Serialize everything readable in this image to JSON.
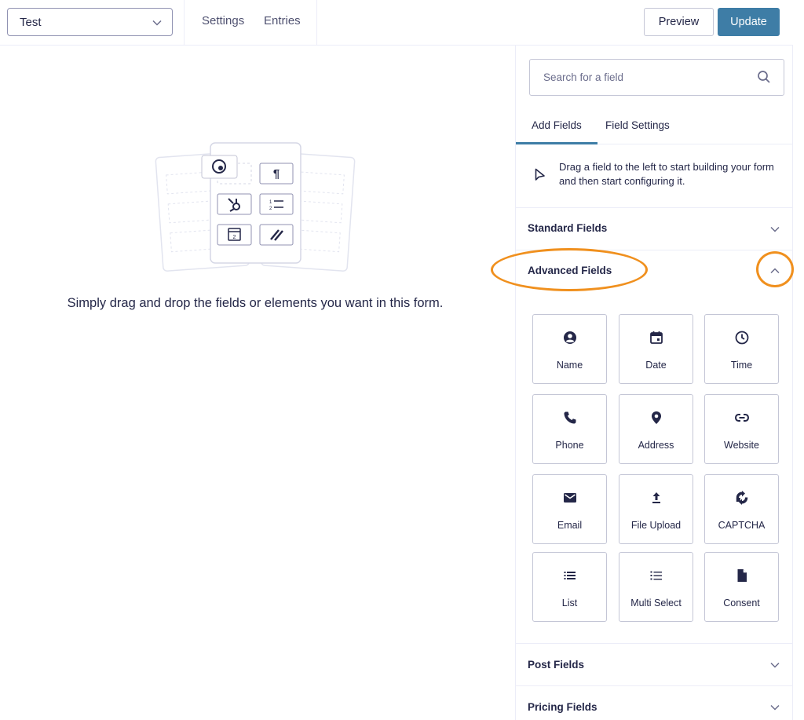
{
  "topbar": {
    "form_selector": {
      "value": "Test"
    },
    "nav": {
      "settings": "Settings",
      "entries": "Entries"
    },
    "preview_label": "Preview",
    "update_label": "Update"
  },
  "canvas": {
    "empty_message": "Simply drag and drop the fields or elements you want in this form."
  },
  "sidebar": {
    "search": {
      "placeholder": "Search for a field",
      "value": ""
    },
    "tabs": [
      {
        "label": "Add Fields",
        "active": true
      },
      {
        "label": "Field Settings",
        "active": false
      }
    ],
    "hint": "Drag a field to the left to start building your form and then start configuring it.",
    "sections": [
      {
        "title": "Standard Fields",
        "expanded": false
      },
      {
        "title": "Advanced Fields",
        "expanded": true
      },
      {
        "title": "Post Fields",
        "expanded": false
      },
      {
        "title": "Pricing Fields",
        "expanded": false
      }
    ],
    "advanced_fields": [
      {
        "label": "Name",
        "icon": "user-circle-icon"
      },
      {
        "label": "Date",
        "icon": "calendar-icon"
      },
      {
        "label": "Time",
        "icon": "clock-icon"
      },
      {
        "label": "Phone",
        "icon": "phone-icon"
      },
      {
        "label": "Address",
        "icon": "map-pin-icon"
      },
      {
        "label": "Website",
        "icon": "link-icon"
      },
      {
        "label": "Email",
        "icon": "envelope-icon"
      },
      {
        "label": "File Upload",
        "icon": "upload-icon"
      },
      {
        "label": "CAPTCHA",
        "icon": "captcha-icon"
      },
      {
        "label": "List",
        "icon": "list-icon"
      },
      {
        "label": "Multi Select",
        "icon": "multi-select-icon"
      },
      {
        "label": "Consent",
        "icon": "document-icon"
      }
    ]
  },
  "colors": {
    "primary": "#3e7da6",
    "text": "#242748",
    "border": "#c4c6d6",
    "divider": "#ecedf8",
    "annotation": "#f0901e"
  }
}
